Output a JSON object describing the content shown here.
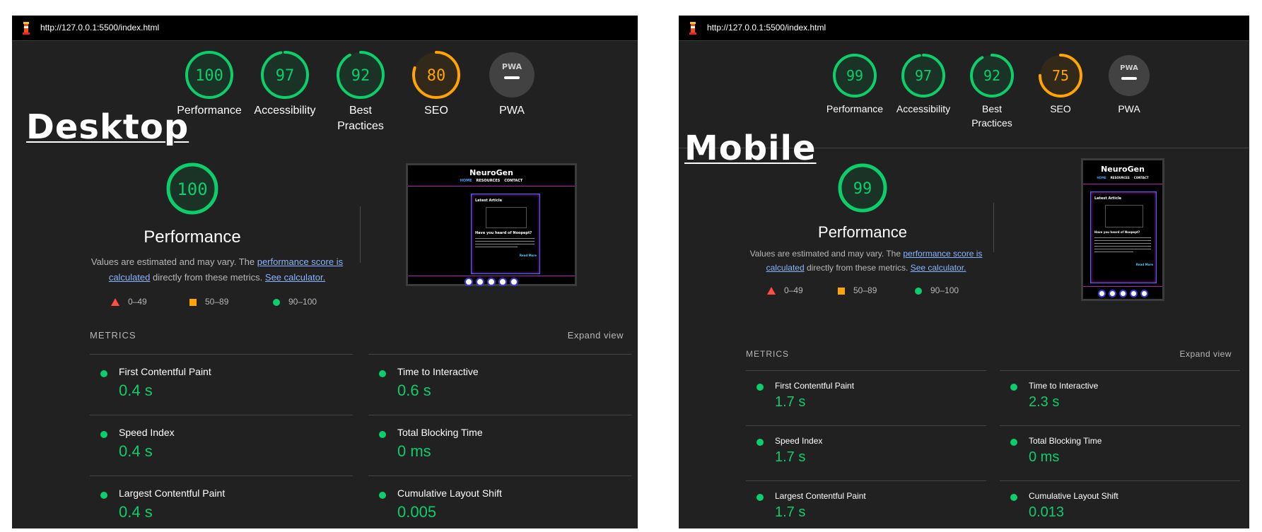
{
  "desktop": {
    "url": "http://127.0.0.1:5500/index.html",
    "overlay_title": "Desktop",
    "gauges": [
      {
        "score": "100",
        "value": 100,
        "label_lines": [
          "Performance"
        ],
        "color": "#0cce6b",
        "fill": "#1a3326"
      },
      {
        "score": "97",
        "value": 97,
        "label_lines": [
          "Accessibility"
        ],
        "color": "#0cce6b",
        "fill": "#1a3326"
      },
      {
        "score": "92",
        "value": 92,
        "label_lines": [
          "Best",
          "Practices"
        ],
        "color": "#0cce6b",
        "fill": "#1a3326"
      },
      {
        "score": "80",
        "value": 80,
        "label_lines": [
          "SEO"
        ],
        "color": "#ffa400",
        "fill": "#33291a"
      },
      {
        "score": "PWA",
        "value": 0,
        "label_lines": [
          "PWA"
        ],
        "color": "#9e9e9e",
        "fill": "#424242",
        "is_pwa": true
      }
    ],
    "perf_score": "100",
    "perf_value": 100,
    "perf_title": "Performance",
    "desc_prefix": "Values are estimated and may vary. The ",
    "desc_link1": "performance score is calculated",
    "desc_mid": " directly from these metrics. ",
    "desc_link2": "See calculator.",
    "legend": [
      "0–49",
      "50–89",
      "90–100"
    ],
    "metrics_header": "METRICS",
    "expand_label": "Expand view",
    "metrics": [
      {
        "title": "First Contentful Paint",
        "value": "0.4 s"
      },
      {
        "title": "Time to Interactive",
        "value": "0.6 s"
      },
      {
        "title": "Speed Index",
        "value": "0.4 s"
      },
      {
        "title": "Total Blocking Time",
        "value": "0 ms"
      },
      {
        "title": "Largest Contentful Paint",
        "value": "0.4 s"
      },
      {
        "title": "Cumulative Layout Shift",
        "value": "0.005"
      }
    ]
  },
  "mobile": {
    "url": "http://127.0.0.1:5500/index.html",
    "overlay_title": "Mobile",
    "gauges": [
      {
        "score": "99",
        "value": 99,
        "label_lines": [
          "Performance"
        ],
        "color": "#0cce6b",
        "fill": "#1a3326"
      },
      {
        "score": "97",
        "value": 97,
        "label_lines": [
          "Accessibility"
        ],
        "color": "#0cce6b",
        "fill": "#1a3326"
      },
      {
        "score": "92",
        "value": 92,
        "label_lines": [
          "Best",
          "Practices"
        ],
        "color": "#0cce6b",
        "fill": "#1a3326"
      },
      {
        "score": "75",
        "value": 75,
        "label_lines": [
          "SEO"
        ],
        "color": "#ffa400",
        "fill": "#33291a"
      },
      {
        "score": "PWA",
        "value": 0,
        "label_lines": [
          "PWA"
        ],
        "color": "#9e9e9e",
        "fill": "#424242",
        "is_pwa": true
      }
    ],
    "perf_score": "99",
    "perf_value": 99,
    "perf_title": "Performance",
    "desc_prefix": "Values are estimated and may vary. The ",
    "desc_link1": "performance score is calculated",
    "desc_mid": " directly from these metrics. ",
    "desc_link2": "See calculator.",
    "legend": [
      "0–49",
      "50–89",
      "90–100"
    ],
    "metrics_header": "METRICS",
    "expand_label": "Expand view",
    "metrics": [
      {
        "title": "First Contentful Paint",
        "value": "1.7 s"
      },
      {
        "title": "Time to Interactive",
        "value": "2.3 s"
      },
      {
        "title": "Speed Index",
        "value": "1.7 s"
      },
      {
        "title": "Total Blocking Time",
        "value": "0 ms"
      },
      {
        "title": "Largest Contentful Paint",
        "value": "1.7 s"
      },
      {
        "title": "Cumulative Layout Shift",
        "value": "0.013"
      }
    ]
  },
  "thumbnail": {
    "brand": "NeuroGen",
    "nav": [
      "HOME",
      "RESOURCES",
      "CONTACT"
    ],
    "article_label": "Latest Article",
    "article_heading": "Have you heard of Noopept?",
    "read_more": "Read More"
  },
  "pwa_badge": "PWA",
  "colors": {
    "pass": "#0cce6b",
    "average": "#ffa400",
    "fail": "#ff4e42",
    "link": "#89b4ff",
    "panel_bg": "#212121"
  }
}
